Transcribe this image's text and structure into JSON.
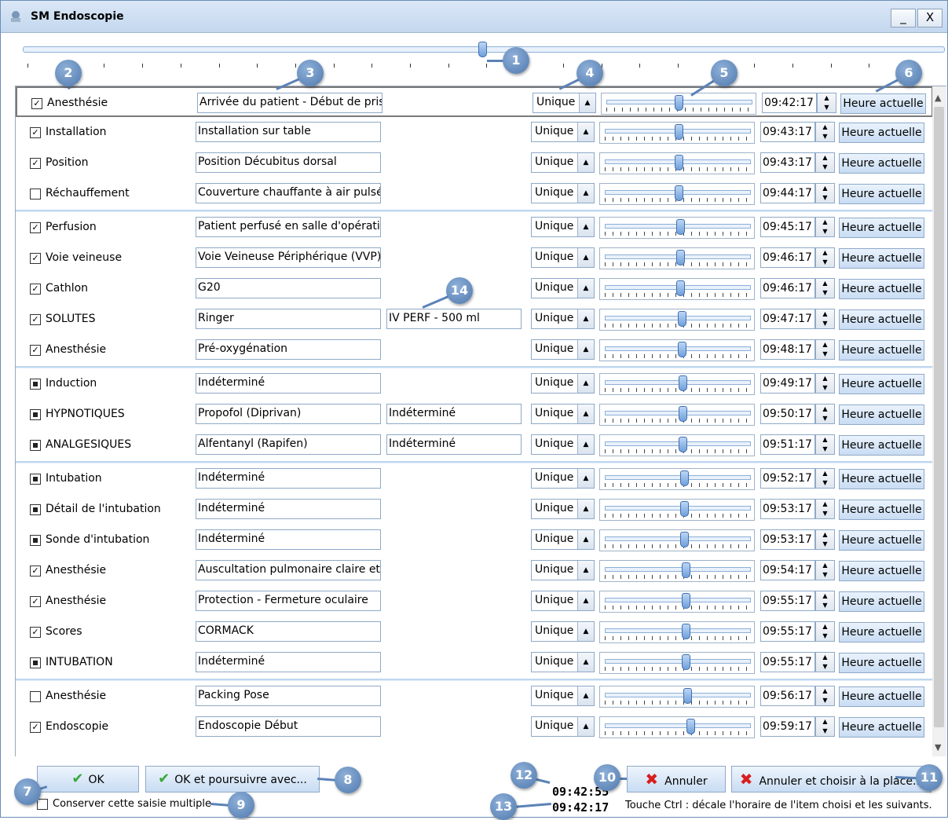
{
  "window": {
    "title": "SM Endoscopie",
    "minimize": "_",
    "close": "X"
  },
  "badges": [
    "1",
    "2",
    "3",
    "4",
    "5",
    "6",
    "7",
    "8",
    "9",
    "10",
    "11",
    "12",
    "13",
    "14"
  ],
  "rows": [
    {
      "check": "checked",
      "label": "Anesthésie",
      "text": "Arrivée du patient - Début de prise en charge",
      "extra": "",
      "mode": "Unique",
      "time": "09:42:17",
      "button": "Heure actuelle",
      "thumb": 0.5,
      "selected": true
    },
    {
      "check": "checked",
      "label": "Installation",
      "text": "Installation sur table",
      "extra": "",
      "mode": "Unique",
      "time": "09:43:17",
      "button": "Heure actuelle",
      "thumb": 0.51
    },
    {
      "check": "checked",
      "label": "Position",
      "text": "Position Décubitus dorsal",
      "extra": "",
      "mode": "Unique",
      "time": "09:43:17",
      "button": "Heure actuelle",
      "thumb": 0.51
    },
    {
      "check": "unchecked",
      "label": "Réchauffement",
      "text": "Couverture chauffante à air pulsé",
      "extra": "",
      "mode": "Unique",
      "time": "09:44:17",
      "button": "Heure actuelle",
      "thumb": 0.51
    },
    {
      "check": "checked",
      "label": "Perfusion",
      "text": "Patient perfusé en salle d'opération",
      "extra": "",
      "mode": "Unique",
      "time": "09:45:17",
      "button": "Heure actuelle",
      "thumb": 0.52
    },
    {
      "check": "checked",
      "label": "Voie veineuse",
      "text": "Voie Veineuse Périphérique (VVP) mi",
      "extra": "",
      "mode": "Unique",
      "time": "09:46:17",
      "button": "Heure actuelle",
      "thumb": 0.52
    },
    {
      "check": "checked",
      "label": "Cathlon",
      "text": "G20",
      "extra": "",
      "mode": "Unique",
      "time": "09:46:17",
      "button": "Heure actuelle",
      "thumb": 0.52
    },
    {
      "check": "checked",
      "label": "SOLUTES",
      "text": "Ringer",
      "extra": "IV PERF - 500 ml",
      "mode": "Unique",
      "time": "09:47:17",
      "button": "Heure actuelle",
      "thumb": 0.53
    },
    {
      "check": "checked",
      "label": "Anesthésie",
      "text": "Pré-oxygénation",
      "extra": "",
      "mode": "Unique",
      "time": "09:48:17",
      "button": "Heure actuelle",
      "thumb": 0.53
    },
    {
      "check": "indeterminate",
      "label": "Induction",
      "text": "Indéterminé",
      "extra": "",
      "mode": "Unique",
      "time": "09:49:17",
      "button": "Heure actuelle",
      "thumb": 0.54
    },
    {
      "check": "indeterminate",
      "label": "HYPNOTIQUES",
      "text": "Propofol (Diprivan)",
      "extra": "Indéterminé",
      "mode": "Unique",
      "time": "09:50:17",
      "button": "Heure actuelle",
      "thumb": 0.54
    },
    {
      "check": "indeterminate",
      "label": "ANALGESIQUES",
      "text": "Alfentanyl (Rapifen)",
      "extra": "Indéterminé",
      "mode": "Unique",
      "time": "09:51:17",
      "button": "Heure actuelle",
      "thumb": 0.54
    },
    {
      "check": "indeterminate",
      "label": "Intubation",
      "text": "Indéterminé",
      "extra": "",
      "mode": "Unique",
      "time": "09:52:17",
      "button": "Heure actuelle",
      "thumb": 0.55
    },
    {
      "check": "indeterminate",
      "label": "Détail de l'intubation",
      "text": "Indéterminé",
      "extra": "",
      "mode": "Unique",
      "time": "09:53:17",
      "button": "Heure actuelle",
      "thumb": 0.55
    },
    {
      "check": "indeterminate",
      "label": "Sonde d'intubation",
      "text": "Indéterminé",
      "extra": "",
      "mode": "Unique",
      "time": "09:53:17",
      "button": "Heure actuelle",
      "thumb": 0.55
    },
    {
      "check": "checked",
      "label": "Anesthésie",
      "text": "Auscultation pulmonaire claire et syr",
      "extra": "",
      "mode": "Unique",
      "time": "09:54:17",
      "button": "Heure actuelle",
      "thumb": 0.56
    },
    {
      "check": "checked",
      "label": "Anesthésie",
      "text": "Protection - Fermeture oculaire",
      "extra": "",
      "mode": "Unique",
      "time": "09:55:17",
      "button": "Heure actuelle",
      "thumb": 0.56
    },
    {
      "check": "checked",
      "label": "Scores",
      "text": "CORMACK",
      "extra": "",
      "mode": "Unique",
      "time": "09:55:17",
      "button": "Heure actuelle",
      "thumb": 0.56
    },
    {
      "check": "indeterminate",
      "label": "INTUBATION",
      "text": "Indéterminé",
      "extra": "",
      "mode": "Unique",
      "time": "09:55:17",
      "button": "Heure actuelle",
      "thumb": 0.56
    },
    {
      "check": "unchecked",
      "label": "Anesthésie",
      "text": "Packing Pose",
      "extra": "",
      "mode": "Unique",
      "time": "09:56:17",
      "button": "Heure actuelle",
      "thumb": 0.57
    },
    {
      "check": "checked",
      "label": "Endoscopie",
      "text": "Endoscopie Début",
      "extra": "",
      "mode": "Unique",
      "time": "09:59:17",
      "button": "Heure actuelle",
      "thumb": 0.59
    }
  ],
  "footer": {
    "ok": "OK",
    "ok_continue": "OK et poursuivre avec...",
    "keep_label": "Conserver cette saisie multiple",
    "cancel": "Annuler",
    "cancel_choose": "Annuler et choisir à la place...",
    "clock_current": "09:42:55",
    "clock_start": "09:42:17",
    "hint": "Touche Ctrl : décale l'horaire de l'item choisi et les suivants."
  },
  "colors": {
    "accent": "#4f78ad",
    "title_bg": "#c3d7ee",
    "check_green": "#39a83a",
    "cross_red": "#d81e1e"
  }
}
